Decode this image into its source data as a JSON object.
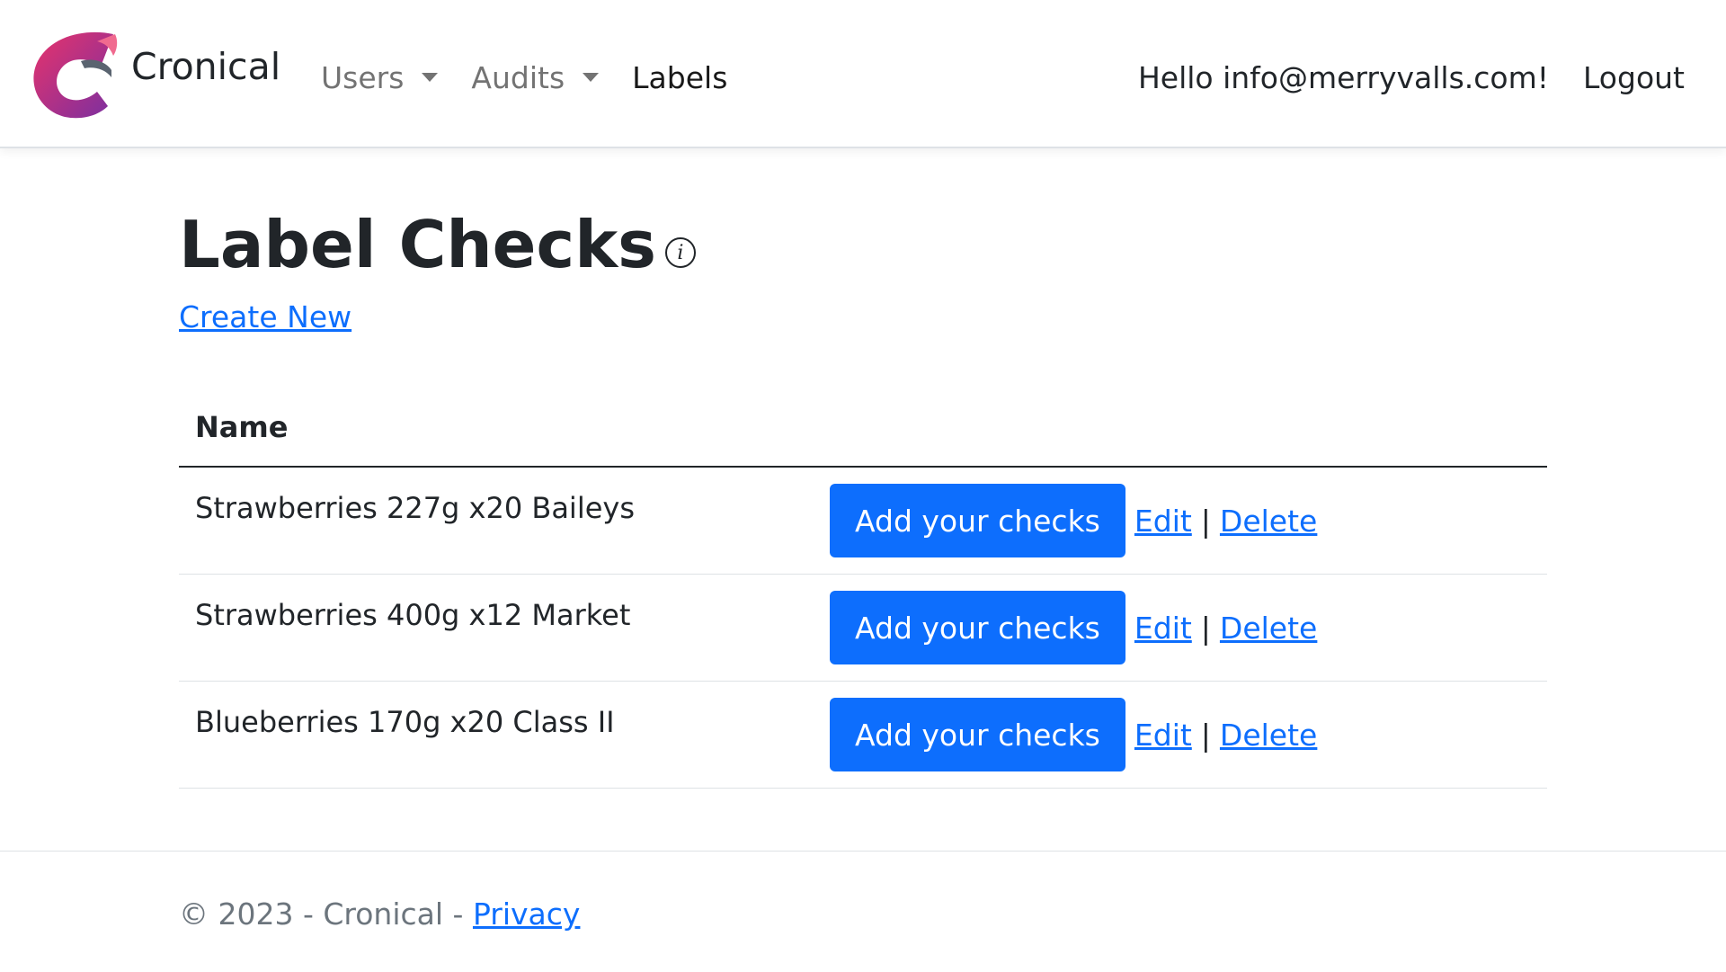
{
  "brand": {
    "name": "Cronical",
    "logo_icon": "cronical-logo-icon",
    "colors": {
      "logo_pink": "#e8336b",
      "logo_purple": "#7b2fa0",
      "logo_gray": "#5a6470"
    }
  },
  "nav": {
    "items": [
      {
        "label": "Users",
        "dropdown": true
      },
      {
        "label": "Audits",
        "dropdown": true
      },
      {
        "label": "Labels",
        "dropdown": false
      }
    ],
    "greeting": "Hello info@merryvalls.com!",
    "logout": "Logout"
  },
  "page": {
    "title": "Label Checks",
    "info_icon": "info-icon",
    "info_glyph": "i",
    "create_new": "Create New"
  },
  "table": {
    "header": "Name",
    "rows": [
      {
        "name": "Strawberries 227g x20 Baileys"
      },
      {
        "name": "Strawberries 400g x12 Market"
      },
      {
        "name": "Blueberries 170g x20 Class II"
      }
    ],
    "actions": {
      "add_checks": "Add your checks",
      "edit": "Edit",
      "separator": "|",
      "delete": "Delete"
    }
  },
  "footer": {
    "text": "© 2023 - Cronical - ",
    "privacy": "Privacy"
  },
  "colors": {
    "primary": "#0d6efd",
    "text": "#212529",
    "muted": "#6c757d",
    "border": "#dee2e6"
  }
}
